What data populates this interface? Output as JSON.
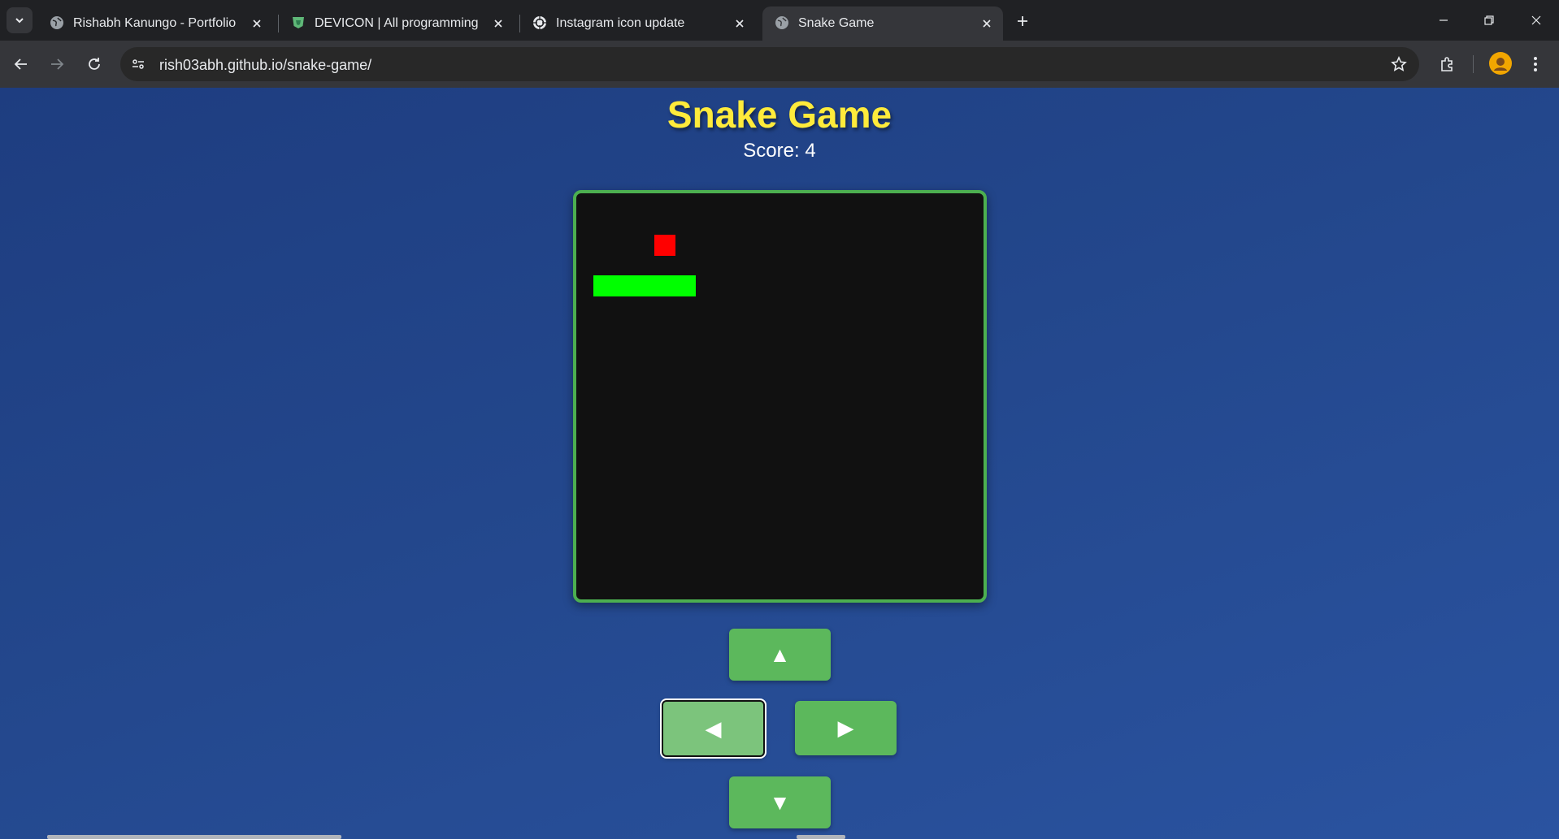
{
  "browser": {
    "tabs": [
      {
        "title": "Rishabh Kanungo - Portfolio",
        "favicon": "globe-icon"
      },
      {
        "title": "DEVICON | All programming languages",
        "favicon": "devicon-shield-icon"
      },
      {
        "title": "Instagram icon update",
        "favicon": "openai-icon"
      },
      {
        "title": "Snake Game",
        "favicon": "globe-icon",
        "active": true
      }
    ],
    "url": "rish03abh.github.io/snake-game/"
  },
  "game": {
    "title": "Snake Game",
    "score_label": "Score: 4",
    "grid": {
      "cols": 20,
      "rows": 20
    },
    "food": {
      "col": 3,
      "row": 2
    },
    "snake": [
      {
        "col": 0,
        "row": 4
      },
      {
        "col": 1,
        "row": 4
      },
      {
        "col": 2,
        "row": 4
      },
      {
        "col": 3,
        "row": 4
      },
      {
        "col": 4,
        "row": 4
      }
    ],
    "colors": {
      "food": "#ff0000",
      "snake": "#00ff00",
      "board_border": "#4caf50",
      "title": "#ffeb3b",
      "button": "#5cb85c"
    }
  },
  "controls": {
    "up": "▲",
    "left": "◀",
    "right": "▶",
    "down": "▼"
  }
}
